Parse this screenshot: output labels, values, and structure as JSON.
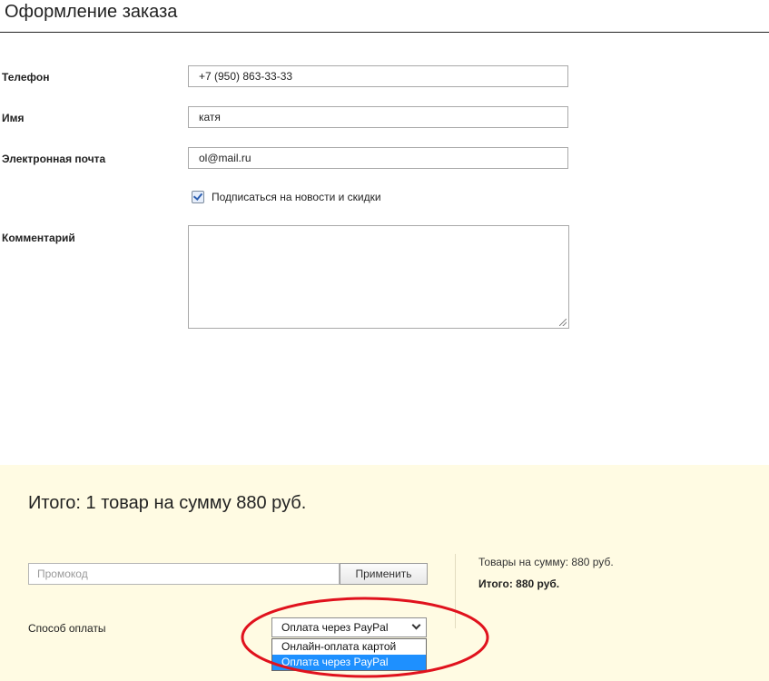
{
  "page": {
    "title": "Оформление заказа"
  },
  "form": {
    "phone": {
      "label": "Телефон",
      "value": "+7 (950) 863-33-33"
    },
    "name": {
      "label": "Имя",
      "value": "катя"
    },
    "email": {
      "label": "Электронная почта",
      "value": "ol@mail.ru"
    },
    "subscribe": {
      "label": "Подписаться на новости и скидки",
      "checked": true
    },
    "comment": {
      "label": "Комментарий",
      "value": ""
    }
  },
  "summary": {
    "heading": "Итого: 1 товар на сумму 880 руб.",
    "promo_placeholder": "Промокод",
    "apply_label": "Применить",
    "payment_label": "Способ оплаты",
    "payment_selected": "Оплата через PayPal",
    "payment_options": [
      "Онлайн-оплата картой",
      "Оплата через PayPal"
    ],
    "goods_sum": "Товары на сумму: 880 руб.",
    "total": "Итого: 880 руб."
  },
  "colors": {
    "summary_background": "#fffbe3",
    "selected_option": "#1e90ff",
    "annotation": "#e0121d"
  },
  "icons": {
    "checkbox": "checkmark-icon",
    "select": "chevron-down-icon",
    "textarea": "resize-grip-icon"
  }
}
